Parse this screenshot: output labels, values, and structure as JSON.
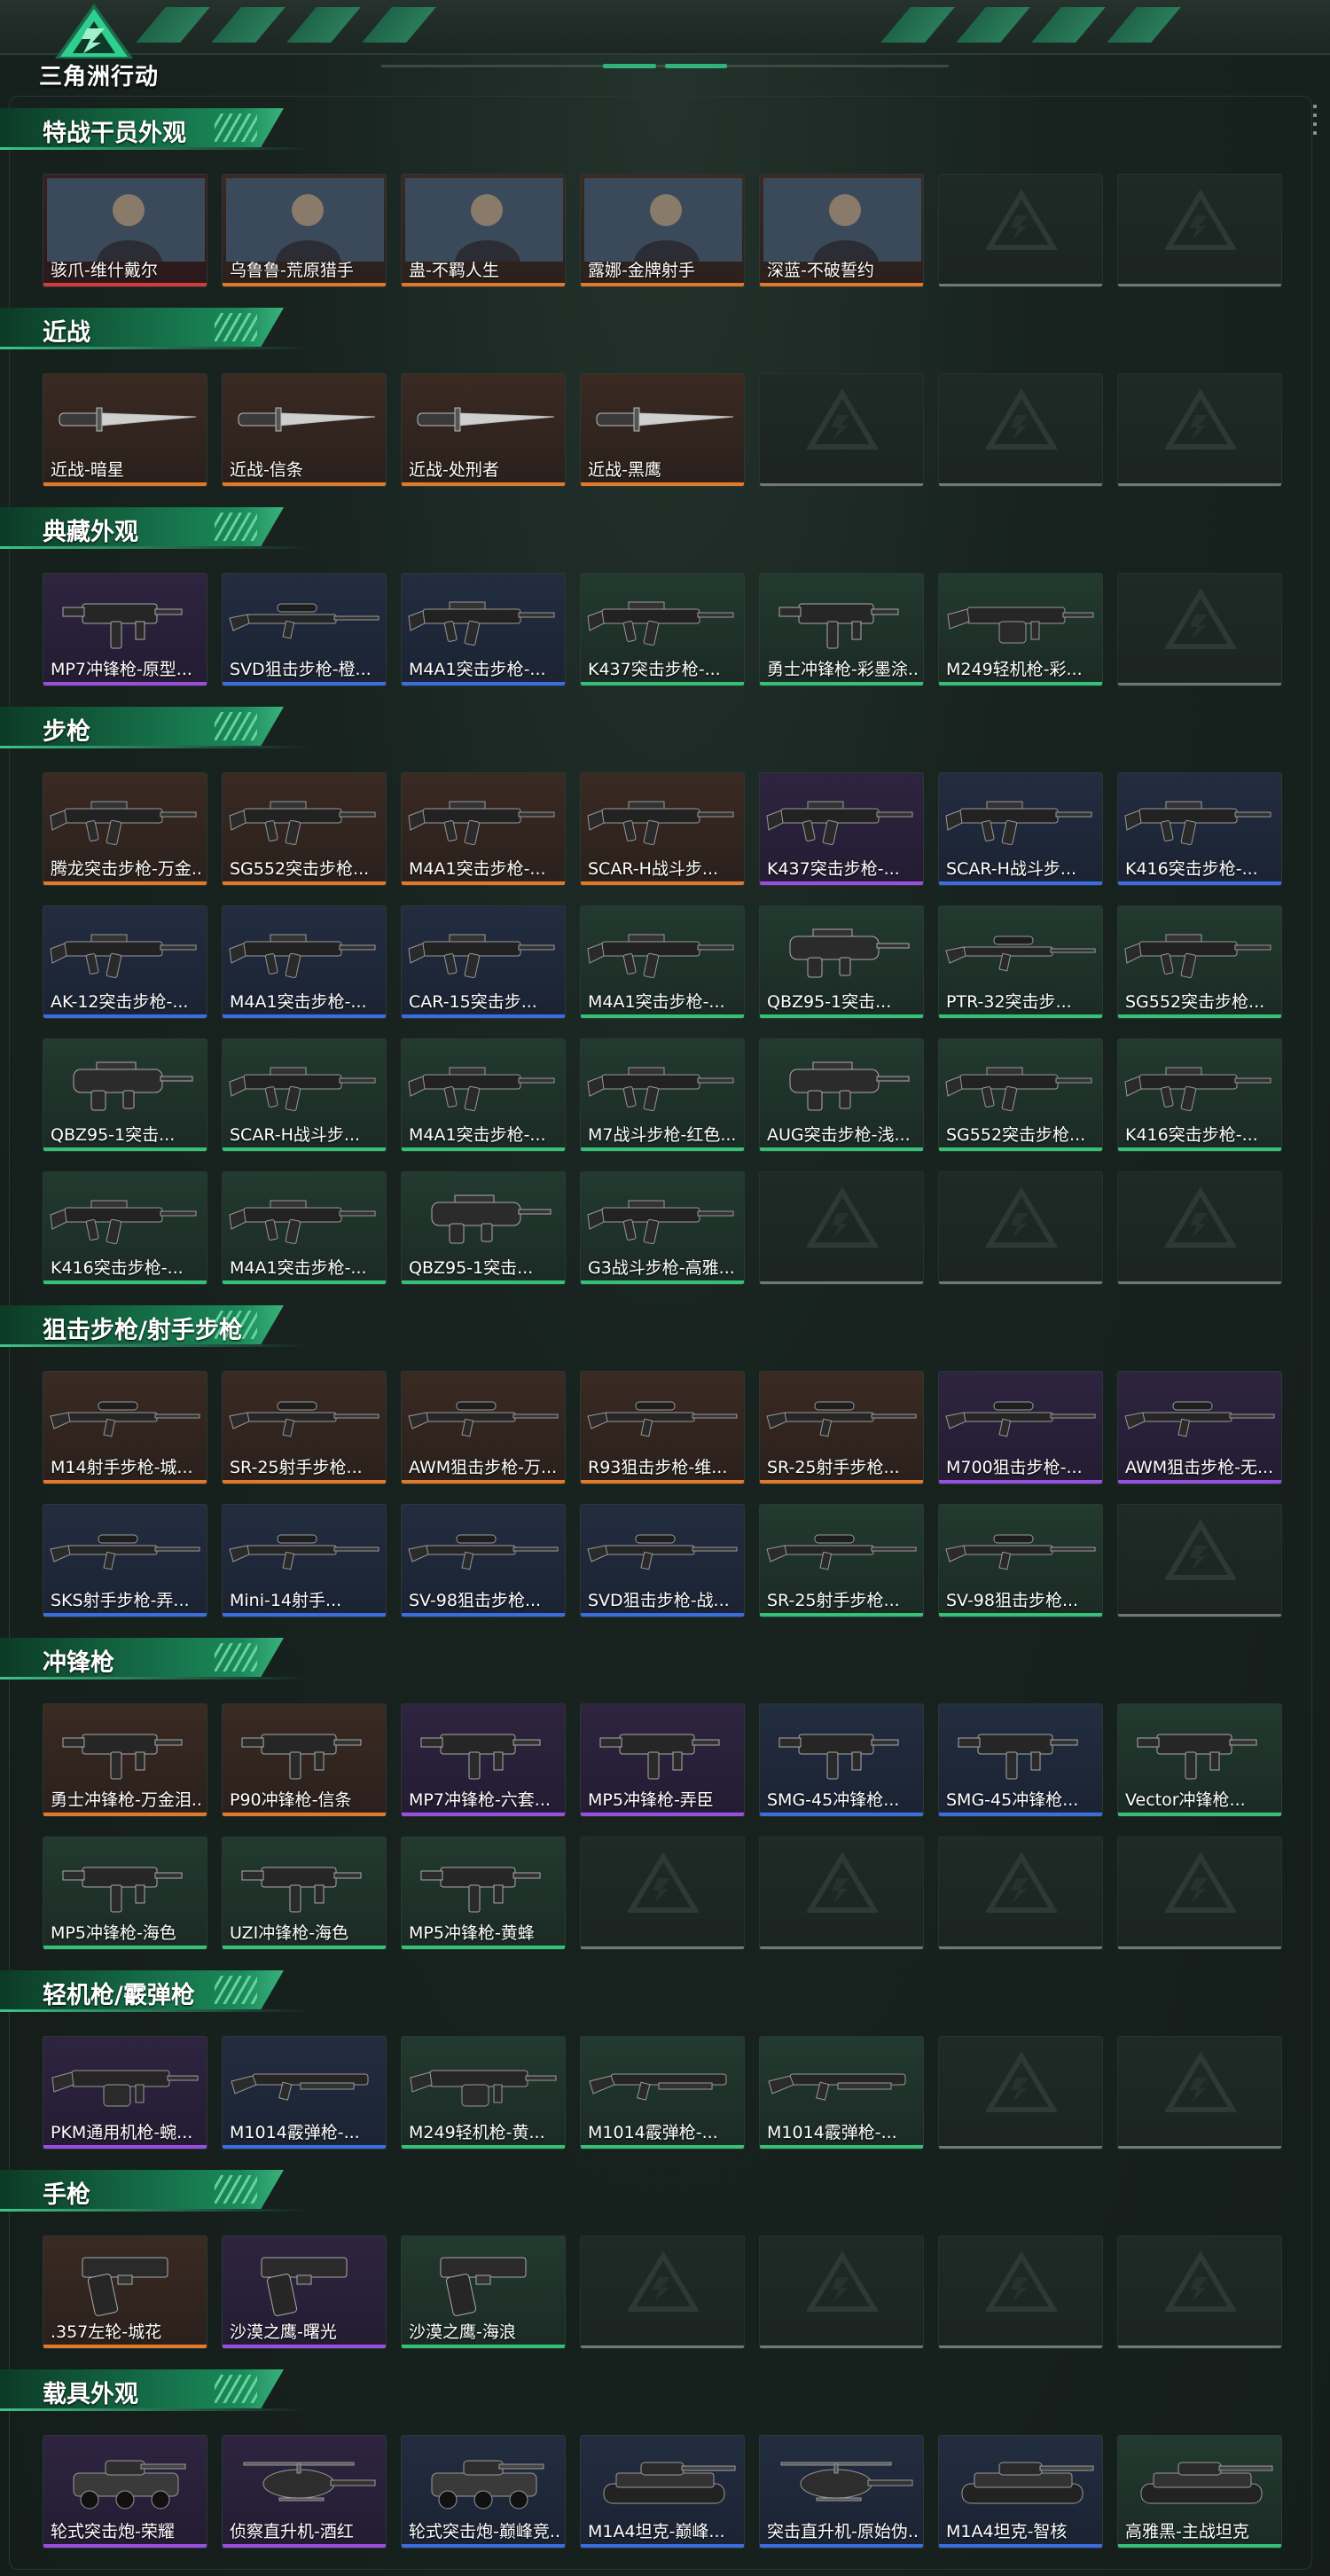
{
  "app": {
    "brand": "三角洲行动"
  },
  "sections": [
    {
      "title": "特战干员外观",
      "rows": [
        [
          {
            "label": "骇爪-维什戴尔",
            "rarity": "red",
            "kind": "portrait"
          },
          {
            "label": "乌鲁鲁-荒原猎手",
            "rarity": "orange",
            "kind": "portrait"
          },
          {
            "label": "蛊-不羁人生",
            "rarity": "orange",
            "kind": "portrait"
          },
          {
            "label": "露娜-金牌射手",
            "rarity": "orange",
            "kind": "portrait"
          },
          {
            "label": "深蓝-不破誓约",
            "rarity": "orange",
            "kind": "portrait"
          },
          {
            "label": "",
            "rarity": "empty"
          },
          {
            "label": "",
            "rarity": "empty"
          }
        ]
      ]
    },
    {
      "title": "近战",
      "rows": [
        [
          {
            "label": "近战-暗星",
            "rarity": "orange",
            "kind": "knife"
          },
          {
            "label": "近战-信条",
            "rarity": "orange",
            "kind": "knife"
          },
          {
            "label": "近战-处刑者",
            "rarity": "orange",
            "kind": "knife"
          },
          {
            "label": "近战-黑鹰",
            "rarity": "orange",
            "kind": "knife"
          },
          {
            "label": "",
            "rarity": "empty"
          },
          {
            "label": "",
            "rarity": "empty"
          },
          {
            "label": "",
            "rarity": "empty"
          }
        ]
      ]
    },
    {
      "title": "典藏外观",
      "rows": [
        [
          {
            "label": "MP7冲锋枪-原型...",
            "rarity": "purple",
            "kind": "smg"
          },
          {
            "label": "SVD狙击步枪-橙...",
            "rarity": "blue",
            "kind": "sniper"
          },
          {
            "label": "M4A1突击步枪-...",
            "rarity": "blue",
            "kind": "rifle"
          },
          {
            "label": "K437突击步枪-...",
            "rarity": "green",
            "kind": "rifle"
          },
          {
            "label": "勇士冲锋枪-彩墨涂...",
            "rarity": "green",
            "kind": "smg"
          },
          {
            "label": "M249轻机枪-彩...",
            "rarity": "green",
            "kind": "lmg"
          },
          {
            "label": "",
            "rarity": "empty"
          }
        ]
      ]
    },
    {
      "title": "步枪",
      "rows": [
        [
          {
            "label": "腾龙突击步枪-万金...",
            "rarity": "orange",
            "kind": "rifle"
          },
          {
            "label": "SG552突击步枪...",
            "rarity": "orange",
            "kind": "rifle"
          },
          {
            "label": "M4A1突击步枪-...",
            "rarity": "orange",
            "kind": "rifle"
          },
          {
            "label": "SCAR-H战斗步...",
            "rarity": "orange",
            "kind": "rifle"
          },
          {
            "label": "K437突击步枪-...",
            "rarity": "purple",
            "kind": "rifle"
          },
          {
            "label": "SCAR-H战斗步...",
            "rarity": "blue",
            "kind": "rifle"
          },
          {
            "label": "K416突击步枪-...",
            "rarity": "blue",
            "kind": "rifle"
          }
        ],
        [
          {
            "label": "AK-12突击步枪-...",
            "rarity": "blue",
            "kind": "rifle"
          },
          {
            "label": "M4A1突击步枪-...",
            "rarity": "blue",
            "kind": "rifle"
          },
          {
            "label": "CAR-15突击步...",
            "rarity": "blue",
            "kind": "rifle"
          },
          {
            "label": "M4A1突击步枪-...",
            "rarity": "green",
            "kind": "rifle"
          },
          {
            "label": "QBZ95-1突击...",
            "rarity": "green",
            "kind": "bullpup"
          },
          {
            "label": "PTR-32突击步...",
            "rarity": "green",
            "kind": "sniper"
          },
          {
            "label": "SG552突击步枪...",
            "rarity": "green",
            "kind": "rifle"
          }
        ],
        [
          {
            "label": "QBZ95-1突击...",
            "rarity": "green",
            "kind": "bullpup"
          },
          {
            "label": "SCAR-H战斗步...",
            "rarity": "green",
            "kind": "rifle"
          },
          {
            "label": "M4A1突击步枪-...",
            "rarity": "green",
            "kind": "rifle"
          },
          {
            "label": "M7战斗步枪-红色...",
            "rarity": "green",
            "kind": "rifle"
          },
          {
            "label": "AUG突击步枪-浅...",
            "rarity": "green",
            "kind": "bullpup"
          },
          {
            "label": "SG552突击步枪...",
            "rarity": "green",
            "kind": "rifle"
          },
          {
            "label": "K416突击步枪-...",
            "rarity": "green",
            "kind": "rifle"
          }
        ],
        [
          {
            "label": "K416突击步枪-...",
            "rarity": "green",
            "kind": "rifle"
          },
          {
            "label": "M4A1突击步枪-...",
            "rarity": "green",
            "kind": "rifle"
          },
          {
            "label": "QBZ95-1突击...",
            "rarity": "green",
            "kind": "bullpup"
          },
          {
            "label": "G3战斗步枪-高雅...",
            "rarity": "green",
            "kind": "rifle"
          },
          {
            "label": "",
            "rarity": "empty"
          },
          {
            "label": "",
            "rarity": "empty"
          },
          {
            "label": "",
            "rarity": "empty"
          }
        ]
      ]
    },
    {
      "title": "狙击步枪/射手步枪",
      "rows": [
        [
          {
            "label": "M14射手步枪-城...",
            "rarity": "orange",
            "kind": "sniper"
          },
          {
            "label": "SR-25射手步枪...",
            "rarity": "orange",
            "kind": "sniper"
          },
          {
            "label": "AWM狙击步枪-万...",
            "rarity": "orange",
            "kind": "sniper"
          },
          {
            "label": "R93狙击步枪-维...",
            "rarity": "orange",
            "kind": "sniper"
          },
          {
            "label": "SR-25射手步枪...",
            "rarity": "orange",
            "kind": "sniper"
          },
          {
            "label": "M700狙击步枪-...",
            "rarity": "purple",
            "kind": "sniper"
          },
          {
            "label": "AWM狙击步枪-无...",
            "rarity": "purple",
            "kind": "sniper"
          }
        ],
        [
          {
            "label": "SKS射手步枪-弄...",
            "rarity": "blue",
            "kind": "sniper"
          },
          {
            "label": "Mini-14射手...",
            "rarity": "blue",
            "kind": "sniper"
          },
          {
            "label": "SV-98狙击步枪...",
            "rarity": "blue",
            "kind": "sniper"
          },
          {
            "label": "SVD狙击步枪-战...",
            "rarity": "blue",
            "kind": "sniper"
          },
          {
            "label": "SR-25射手步枪...",
            "rarity": "green",
            "kind": "sniper"
          },
          {
            "label": "SV-98狙击步枪...",
            "rarity": "green",
            "kind": "sniper"
          },
          {
            "label": "",
            "rarity": "empty"
          }
        ]
      ]
    },
    {
      "title": "冲锋枪",
      "rows": [
        [
          {
            "label": "勇士冲锋枪-万金泪...",
            "rarity": "orange",
            "kind": "smg"
          },
          {
            "label": "P90冲锋枪-信条",
            "rarity": "orange",
            "kind": "smg"
          },
          {
            "label": "MP7冲锋枪-六套...",
            "rarity": "purple",
            "kind": "smg"
          },
          {
            "label": "MP5冲锋枪-弄臣",
            "rarity": "purple",
            "kind": "smg"
          },
          {
            "label": "SMG-45冲锋枪...",
            "rarity": "blue",
            "kind": "smg"
          },
          {
            "label": "SMG-45冲锋枪...",
            "rarity": "blue",
            "kind": "smg"
          },
          {
            "label": "Vector冲锋枪...",
            "rarity": "green",
            "kind": "smg"
          }
        ],
        [
          {
            "label": "MP5冲锋枪-海色",
            "rarity": "green",
            "kind": "smg"
          },
          {
            "label": "UZI冲锋枪-海色",
            "rarity": "green",
            "kind": "smg"
          },
          {
            "label": "MP5冲锋枪-黄蜂",
            "rarity": "green",
            "kind": "smg"
          },
          {
            "label": "",
            "rarity": "empty"
          },
          {
            "label": "",
            "rarity": "empty"
          },
          {
            "label": "",
            "rarity": "empty"
          },
          {
            "label": "",
            "rarity": "empty"
          }
        ]
      ]
    },
    {
      "title": "轻机枪/霰弹枪",
      "rows": [
        [
          {
            "label": "PKM通用机枪-蜿...",
            "rarity": "purple",
            "kind": "lmg"
          },
          {
            "label": "M1014霰弹枪-...",
            "rarity": "blue",
            "kind": "shotgun"
          },
          {
            "label": "M249轻机枪-黄...",
            "rarity": "green",
            "kind": "lmg"
          },
          {
            "label": "M1014霰弹枪-...",
            "rarity": "green",
            "kind": "shotgun"
          },
          {
            "label": "M1014霰弹枪-...",
            "rarity": "green",
            "kind": "shotgun"
          },
          {
            "label": "",
            "rarity": "empty"
          },
          {
            "label": "",
            "rarity": "empty"
          }
        ]
      ]
    },
    {
      "title": "手枪",
      "rows": [
        [
          {
            "label": ".357左轮-城花",
            "rarity": "orange",
            "kind": "pistol"
          },
          {
            "label": "沙漠之鹰-曙光",
            "rarity": "purple",
            "kind": "pistol"
          },
          {
            "label": "沙漠之鹰-海浪",
            "rarity": "green",
            "kind": "pistol"
          },
          {
            "label": "",
            "rarity": "empty"
          },
          {
            "label": "",
            "rarity": "empty"
          },
          {
            "label": "",
            "rarity": "empty"
          },
          {
            "label": "",
            "rarity": "empty"
          }
        ]
      ]
    },
    {
      "title": "载具外观",
      "rows": [
        [
          {
            "label": "轮式突击炮-荣耀",
            "rarity": "purple",
            "kind": "vehicle"
          },
          {
            "label": "侦察直升机-酒红",
            "rarity": "purple",
            "kind": "heli"
          },
          {
            "label": "轮式突击炮-巅峰竞...",
            "rarity": "blue",
            "kind": "vehicle"
          },
          {
            "label": "M1A4坦克-巅峰...",
            "rarity": "blue",
            "kind": "tank"
          },
          {
            "label": "突击直升机-原始伪...",
            "rarity": "blue",
            "kind": "heli"
          },
          {
            "label": "M1A4坦克-智核",
            "rarity": "blue",
            "kind": "tank"
          },
          {
            "label": "高雅黑-主战坦克",
            "rarity": "green",
            "kind": "tank"
          }
        ]
      ]
    }
  ],
  "colors": {
    "orange": "#e07a2a",
    "purple": "#9a4ee0",
    "blue": "#3a6de0",
    "green": "#35c07a",
    "red": "#d83a3a",
    "accent": "#2fb37a"
  }
}
